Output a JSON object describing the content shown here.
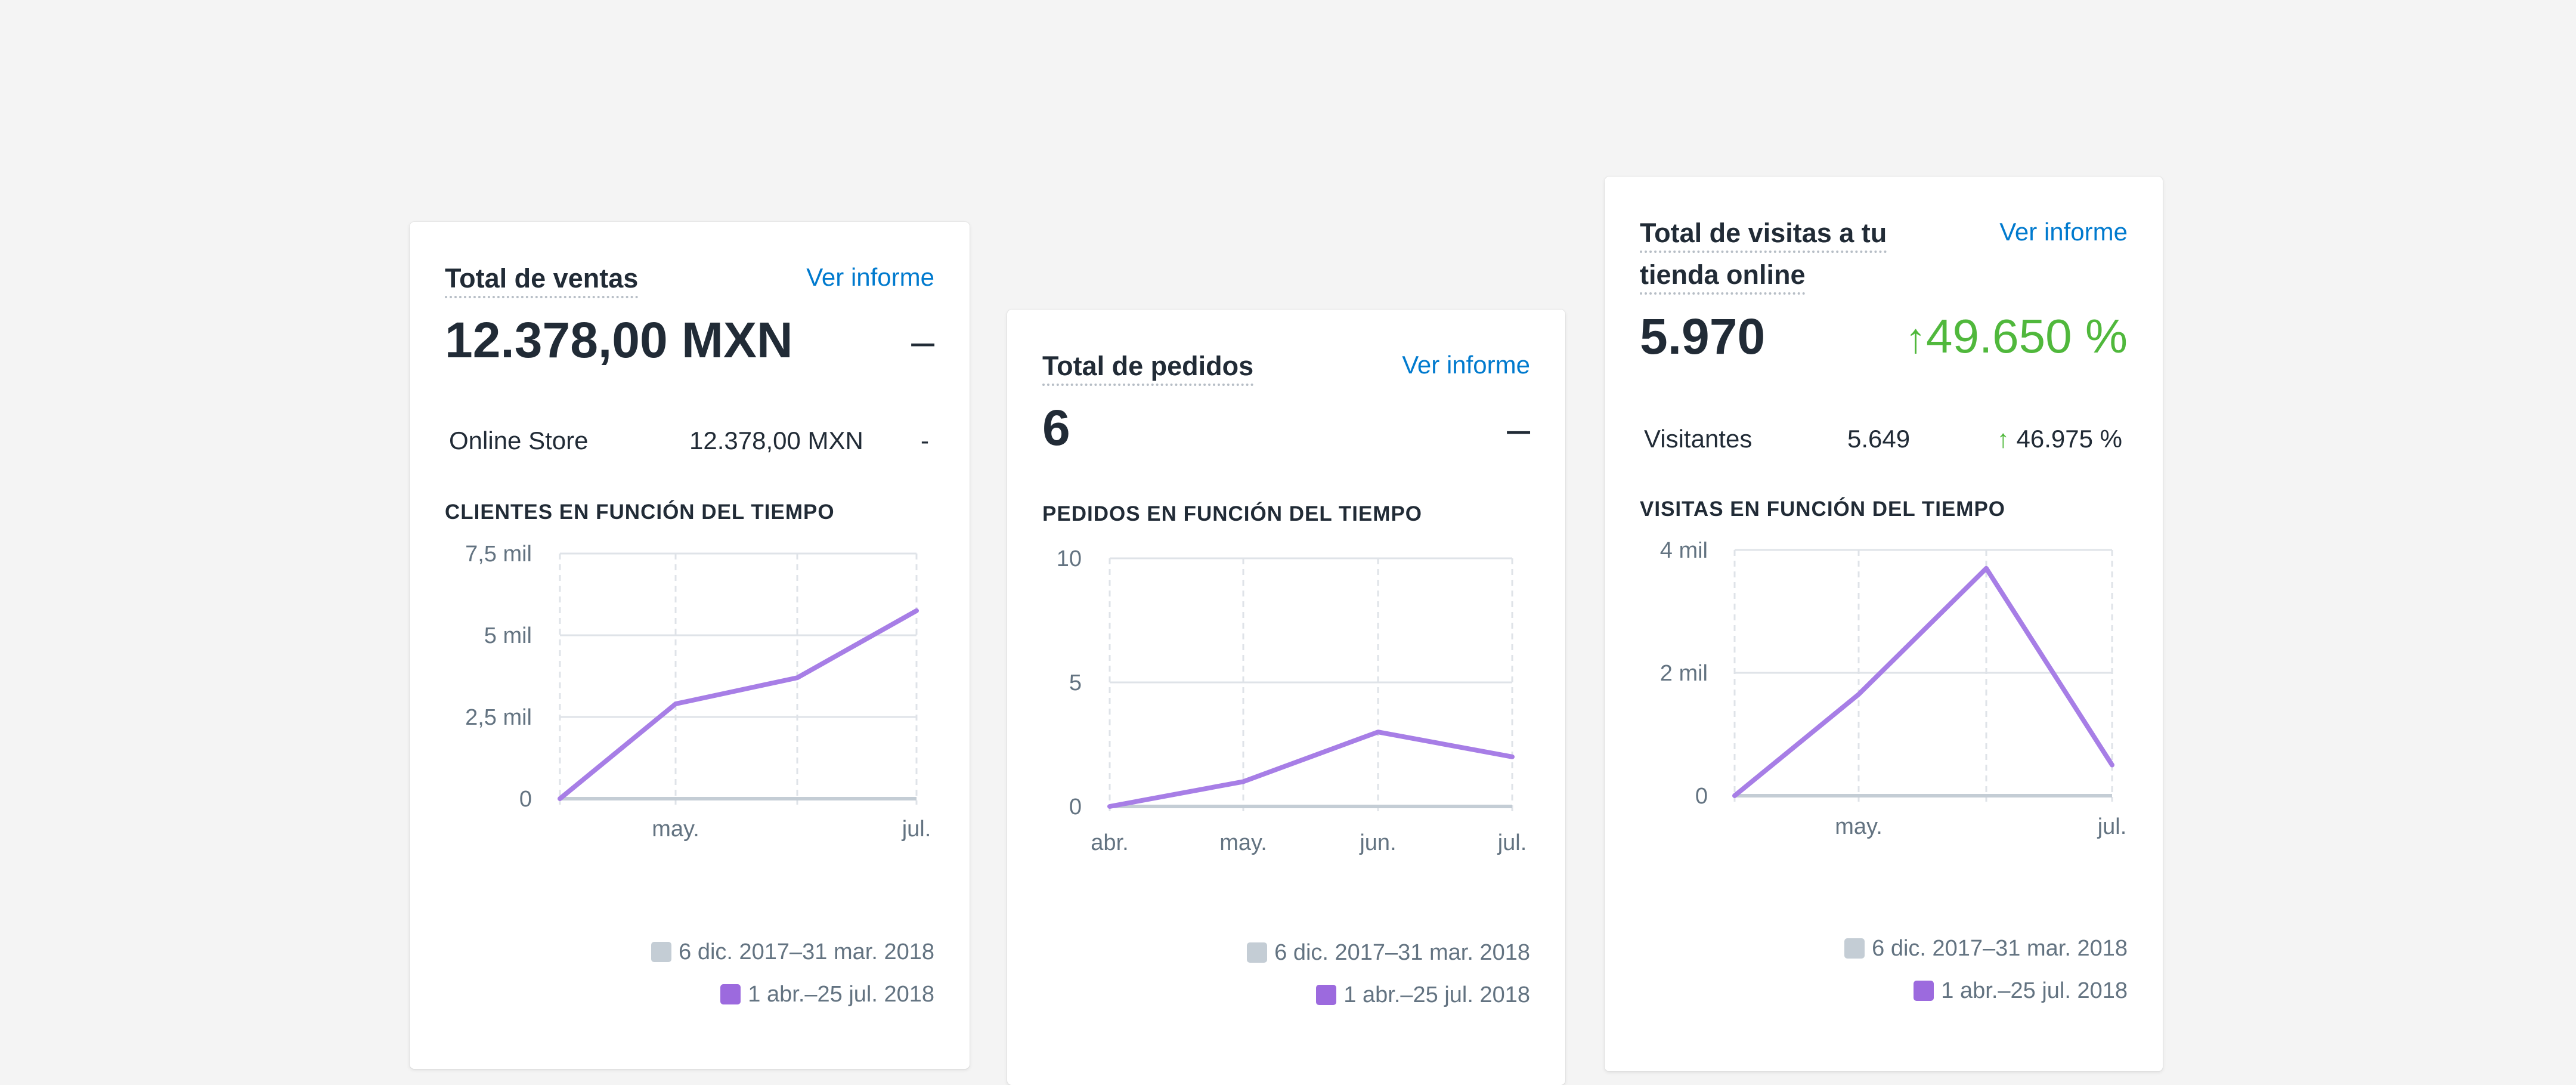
{
  "colors": {
    "accent": "#a77ee6",
    "legend_current": "#9c6ade",
    "legend_previous": "#c4cdd5",
    "positive": "#50b83c",
    "link": "#007ace"
  },
  "cards": [
    {
      "title": "Total de ventas",
      "link": "Ver informe",
      "metric": "12.378,00 MXN",
      "change": "–",
      "breakdown": {
        "label": "Online Store",
        "value": "12.378,00 MXN",
        "change": "-"
      },
      "chart_title": "CLIENTES EN FUNCIÓN DEL TIEMPO",
      "legend": {
        "previous": "6 dic. 2017–31 mar. 2018",
        "current": "1 abr.–25 jul. 2018"
      }
    },
    {
      "title": "Total de pedidos",
      "link": "Ver informe",
      "metric": "6",
      "change": "–",
      "chart_title": "PEDIDOS EN FUNCIÓN DEL TIEMPO",
      "legend": {
        "previous": "6 dic. 2017–31 mar. 2018",
        "current": "1 abr.–25 jul. 2018"
      }
    },
    {
      "title_line1": "Total de visitas a tu",
      "title_line2": "tienda online",
      "link": "Ver informe",
      "metric": "5.970",
      "change": "49.650 %",
      "breakdown": {
        "label": "Visitantes",
        "value": "5.649",
        "change": "46.975 %"
      },
      "chart_title": "VISITAS EN FUNCIÓN DEL TIEMPO",
      "legend": {
        "previous": "6 dic. 2017–31 mar. 2018",
        "current": "1 abr.–25 jul. 2018"
      }
    }
  ],
  "chart_data": [
    {
      "type": "line",
      "x_ticks": [
        "may.",
        "jul."
      ],
      "y_ticks": [
        "0",
        "2,5 mil",
        "5 mil",
        "7,5 mil"
      ],
      "ylim": [
        0,
        7500
      ],
      "series": [
        {
          "name": "1 abr.–25 jul. 2018",
          "x": [
            0,
            1,
            2,
            3
          ],
          "values": [
            0,
            2900,
            3700,
            5750
          ]
        },
        {
          "name": "6 dic. 2017–31 mar. 2018",
          "x": [
            0,
            3
          ],
          "values": [
            0,
            0
          ]
        }
      ]
    },
    {
      "type": "line",
      "x_ticks": [
        "abr.",
        "may.",
        "jun.",
        "jul."
      ],
      "y_ticks": [
        "0",
        "5",
        "10"
      ],
      "ylim": [
        0,
        10
      ],
      "series": [
        {
          "name": "1 abr.–25 jul. 2018",
          "x": [
            0,
            1,
            2,
            3
          ],
          "values": [
            0,
            1,
            3,
            2
          ]
        },
        {
          "name": "6 dic. 2017–31 mar. 2018",
          "x": [
            0,
            3
          ],
          "values": [
            0,
            0
          ]
        }
      ]
    },
    {
      "type": "line",
      "x_ticks": [
        "may.",
        "jul."
      ],
      "y_ticks": [
        "0",
        "2 mil",
        "4 mil"
      ],
      "ylim": [
        0,
        4000
      ],
      "series": [
        {
          "name": "1 abr.–25 jul. 2018",
          "x": [
            0,
            1,
            2,
            3
          ],
          "values": [
            0,
            1650,
            3700,
            500
          ]
        },
        {
          "name": "6 dic. 2017–31 mar. 2018",
          "x": [
            0,
            3
          ],
          "values": [
            0,
            0
          ]
        }
      ]
    }
  ]
}
